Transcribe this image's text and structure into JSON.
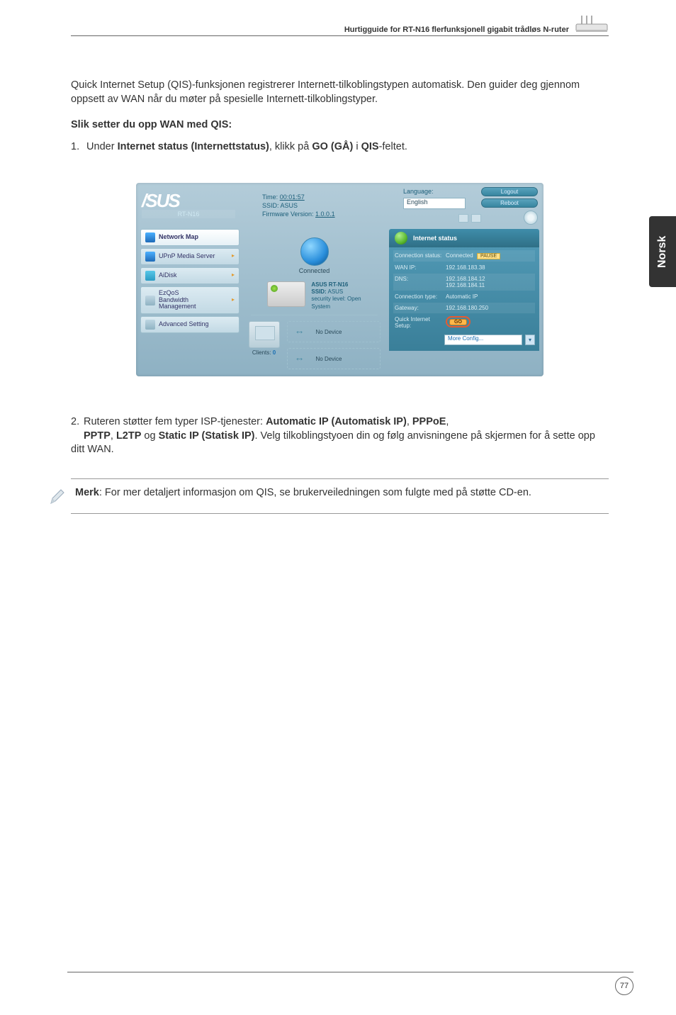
{
  "header": {
    "title": "Hurtigguide for RT-N16 flerfunksjonell gigabit trådløs N-ruter"
  },
  "sideTab": "Norsk",
  "intro": "Quick Internet Setup (QIS)-funksjonen registrerer Internett-tilkoblingstypen automatisk. Den guider deg gjennom oppsett av WAN når du møter på spesielle Internett-tilkoblingstyper.",
  "heading": "Slik setter du opp WAN med QIS:",
  "step1": {
    "num": "1.",
    "pre": "Under ",
    "b1": "Internet status (Internettstatus)",
    "mid": ", klikk på ",
    "b2": "GO (GÅ)",
    "mid2": " i ",
    "b3": "QIS",
    "post": "-feltet."
  },
  "shot": {
    "model": "RT-N16",
    "timeLabel": "Time:",
    "timeVal": "00:01:57",
    "ssidLabel": "SSID:",
    "ssidVal": "ASUS",
    "fwLabel": "Firmware Version:",
    "fwVal": "1.0.0.1",
    "langLabel": "Language:",
    "langVal": "English",
    "logout": "Logout",
    "reboot": "Reboot",
    "sidebar": {
      "networkMap": "Network Map",
      "upnp": "UPnP Media Server",
      "aidisk": "AiDisk",
      "ezqos": "EzQoS\nBandwidth\nManagement",
      "adv": "Advanced Setting"
    },
    "center": {
      "connected": "Connected",
      "specLine1": "ASUS RT-N16",
      "specLine2a": "SSID:",
      "specLine2b": "ASUS",
      "specLine3": "security level: Open",
      "specLine4": "System",
      "clientsLabel": "Clients:",
      "clientsVal": "0",
      "noDevice": "No Device"
    },
    "right": {
      "title": "Internet status",
      "rows": {
        "connStatusK": "Connection status:",
        "connStatusV": "Connected",
        "pause": "PAUSE",
        "wanIpK": "WAN IP:",
        "wanIpV": "192.168.183.38",
        "dnsK": "DNS:",
        "dnsV1": "192.168.184.12",
        "dnsV2": "192.168.184.11",
        "connTypeK": "Connection type:",
        "connTypeV": "Automatic IP",
        "gatewayK": "Gateway:",
        "gatewayV": "192.168.180.250",
        "qisK": "Quick Internet Setup:",
        "go": "GO",
        "more": "More Config..."
      }
    }
  },
  "step2": {
    "num": "2.",
    "pre": "Ruteren støtter fem typer ISP-tjenester:  ",
    "b1": "Automatic IP (Automatisk IP)",
    "s1": ", ",
    "b2": "PPPoE",
    "s2": ", ",
    "b3": "PPTP",
    "s3": ", ",
    "b4": "L2TP",
    "s4": " og ",
    "b5": "Static IP (Statisk IP)",
    "post": ". Velg tilkoblingstyoen din og følg anvisningene på skjermen for å sette opp ditt WAN."
  },
  "note": {
    "b": "Merk",
    "text": ": For mer detaljert informasjon om QIS, se brukerveiledningen som fulgte med på støtte CD-en."
  },
  "pageNumber": "77"
}
